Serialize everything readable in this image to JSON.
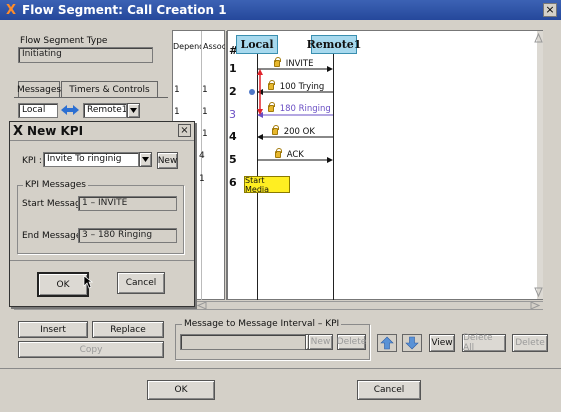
{
  "window": {
    "title": "Flow Segment: Call Creation 1",
    "close": "×"
  },
  "left": {
    "flow_type_label": "Flow Segment Type",
    "flow_type_value": "Initiating",
    "tabs": [
      "Messages",
      "Timers & Controls"
    ],
    "from_value": "Local",
    "to_value": "Remote1",
    "insert": "Insert",
    "replace": "Replace",
    "copy": "Copy"
  },
  "table": {
    "headers": [
      "Depend",
      "Associ",
      "#"
    ],
    "rows": [
      {
        "dep": "",
        "assoc": "",
        "num": "1"
      },
      {
        "dep": "1",
        "assoc": "1",
        "num": "2"
      },
      {
        "dep": "1",
        "assoc": "1",
        "num": "3"
      },
      {
        "dep": "1",
        "assoc": "1",
        "num": "4"
      },
      {
        "dep": "4",
        "assoc": "",
        "num": "5"
      },
      {
        "dep": "1",
        "assoc": "",
        "num": "6"
      }
    ]
  },
  "sequence": {
    "lanes": [
      "Local",
      "Remote1"
    ],
    "messages": [
      "INVITE",
      "100 Trying",
      "180 Ringing",
      "200 OK",
      "ACK"
    ],
    "start_media": "Start Media"
  },
  "kpi_dialog": {
    "title": "New KPI",
    "close": "×",
    "kpi_label": "KPI :",
    "kpi_value": "Invite To ringinig",
    "new": "New",
    "group_title": "KPI Messages",
    "start_label": "Start Message :",
    "start_value": "1 – INVITE",
    "end_label": "End Message   :",
    "end_value": "3 – 180 Ringing",
    "ok": "OK",
    "cancel": "Cancel"
  },
  "interval": {
    "label": "Message to Message Interval – KPI",
    "new": "New",
    "delete": "Delete",
    "view": "View",
    "delete_all": "Delete All",
    "delete2": "Delete"
  },
  "footer": {
    "ok": "OK",
    "cancel": "Cancel"
  },
  "colors": {
    "title_bar": "#25489b",
    "lane_header": "#a7d9ee",
    "start_media": "#ffee22",
    "ringing_text": "#6a4fc4",
    "red_arrow": "#e0242c",
    "blue_arrow": "#4f78c8"
  }
}
